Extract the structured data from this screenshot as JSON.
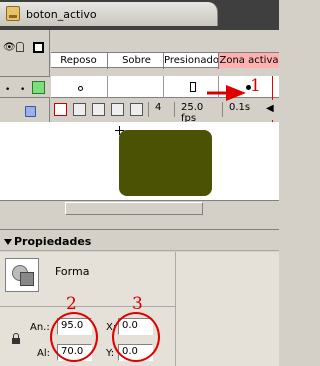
{
  "tab": {
    "title": "boton_activo"
  },
  "timeline": {
    "frames": [
      "Reposo",
      "Sobre",
      "Presionado",
      "Zona activa"
    ],
    "current_frame": "4",
    "fps": "25.0 fps",
    "elapsed": "0.1s",
    "annotation_1": "1"
  },
  "stage": {
    "shape_color": "#4b5203"
  },
  "properties": {
    "title": "Propiedades",
    "shape_type": "Forma",
    "width_label": "An.:",
    "width_value": "95.0",
    "height_label": "Al:",
    "height_value": "70.0",
    "x_label": "X:",
    "x_value": "0.0",
    "y_label": "Y:",
    "y_value": "0.0",
    "annotation_2": "2",
    "annotation_3": "3"
  }
}
